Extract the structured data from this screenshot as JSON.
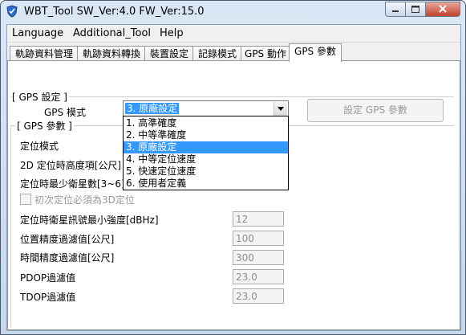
{
  "window": {
    "title": "WBT_Tool  SW_Ver:4.0   FW_Ver:15.0"
  },
  "menu": [
    "Language",
    "Additional_Tool",
    "Help"
  ],
  "tabs": [
    "軌跡資料管理",
    "軌跡資料轉換",
    "裝置設定",
    "記錄模式",
    "GPS 動作",
    "GPS 參數"
  ],
  "active_tab": "GPS 參數",
  "gps_settings": {
    "group_label": "[ GPS 設定 ]",
    "mode_label": "GPS 模式",
    "mode_value": "3. 原廠設定",
    "mode_options": [
      "1. 高準確度",
      "2. 中等準確度",
      "3. 原廠設定",
      "4. 中等定位速度",
      "5. 快速定位速度",
      "6. 使用者定義"
    ],
    "apply_button": "設定 GPS 參數"
  },
  "gps_params": {
    "group_label": "[ GPS 參數 ]",
    "fix_mode_label": "定位模式",
    "alt_label": "2D 定位時高度項[公尺]",
    "min_sat_label": "定位時最少衛星數[3~6]",
    "first_fix_3d_label": "初次定位必須為3D定位",
    "min_snr_label": "定位時衛星訊號最小強度[dBHz]",
    "min_snr_value": "12",
    "pos_acc_label": "位置精度過濾值[公尺]",
    "pos_acc_value": "100",
    "time_acc_label": "時間精度過濾值[公尺]",
    "time_acc_value": "300",
    "pdop_label": "PDOP過濾值",
    "pdop_value": "23.0",
    "tdop_label": "TDOP過濾值",
    "tdop_value": "23.0"
  }
}
